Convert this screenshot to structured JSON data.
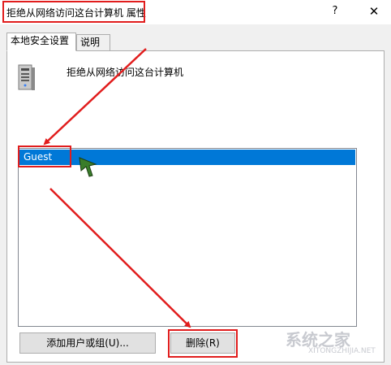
{
  "window": {
    "title": "拒绝从网络访问这台计算机 属性",
    "help_label": "?",
    "close_label": "✕"
  },
  "tabs": [
    {
      "label": "本地安全设置",
      "active": true
    },
    {
      "label": "说明",
      "active": false
    }
  ],
  "policy": {
    "icon": "server-icon",
    "name": "拒绝从网络访问这台计算机"
  },
  "accounts": {
    "items": [
      {
        "label": "Guest",
        "selected": true
      }
    ]
  },
  "buttons": {
    "add_label": "添加用户或组(U)...",
    "delete_label": "删除(R)"
  },
  "annotations": {
    "highlight_color": "#e11d1d"
  },
  "watermark": {
    "text": "系统之家",
    "sub": "XITONGZHIJIA.NET"
  }
}
